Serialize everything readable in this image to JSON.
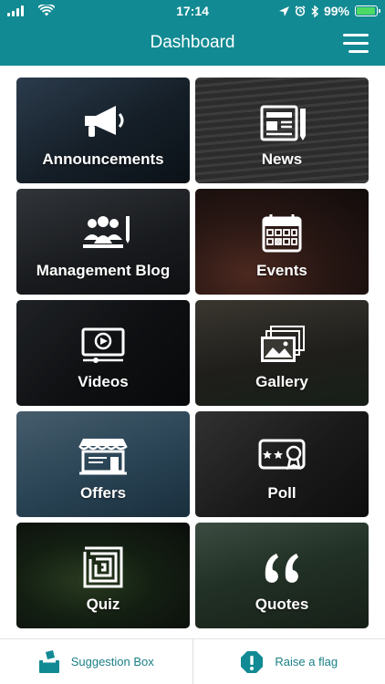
{
  "status_bar": {
    "time": "17:14",
    "battery_percent": "99%",
    "battery_level": 0.99
  },
  "header": {
    "title": "Dashboard"
  },
  "tiles": [
    {
      "label": "Announcements",
      "icon": "megaphone-icon",
      "bg": "#2b3a4a"
    },
    {
      "label": "News",
      "icon": "newspaper-icon",
      "bg": "#5a5a5a"
    },
    {
      "label": "Management Blog",
      "icon": "team-icon",
      "bg": "#3a3f46"
    },
    {
      "label": "Events",
      "icon": "calendar-icon",
      "bg": "#4a2f2a"
    },
    {
      "label": "Videos",
      "icon": "video-icon",
      "bg": "#202428"
    },
    {
      "label": "Gallery",
      "icon": "images-icon",
      "bg": "#3c3a34"
    },
    {
      "label": "Offers",
      "icon": "storefront-icon",
      "bg": "#3c6a86"
    },
    {
      "label": "Poll",
      "icon": "ballot-icon",
      "bg": "#2e2e2e"
    },
    {
      "label": "Quiz",
      "icon": "maze-icon",
      "bg": "#23302a"
    },
    {
      "label": "Quotes",
      "icon": "quote-icon",
      "bg": "#3a4a3a"
    }
  ],
  "footer": {
    "suggestion_label": "Suggestion Box",
    "flag_label": "Raise a flag"
  },
  "colors": {
    "brand": "#128a93",
    "footer_text": "#1a7f87"
  }
}
